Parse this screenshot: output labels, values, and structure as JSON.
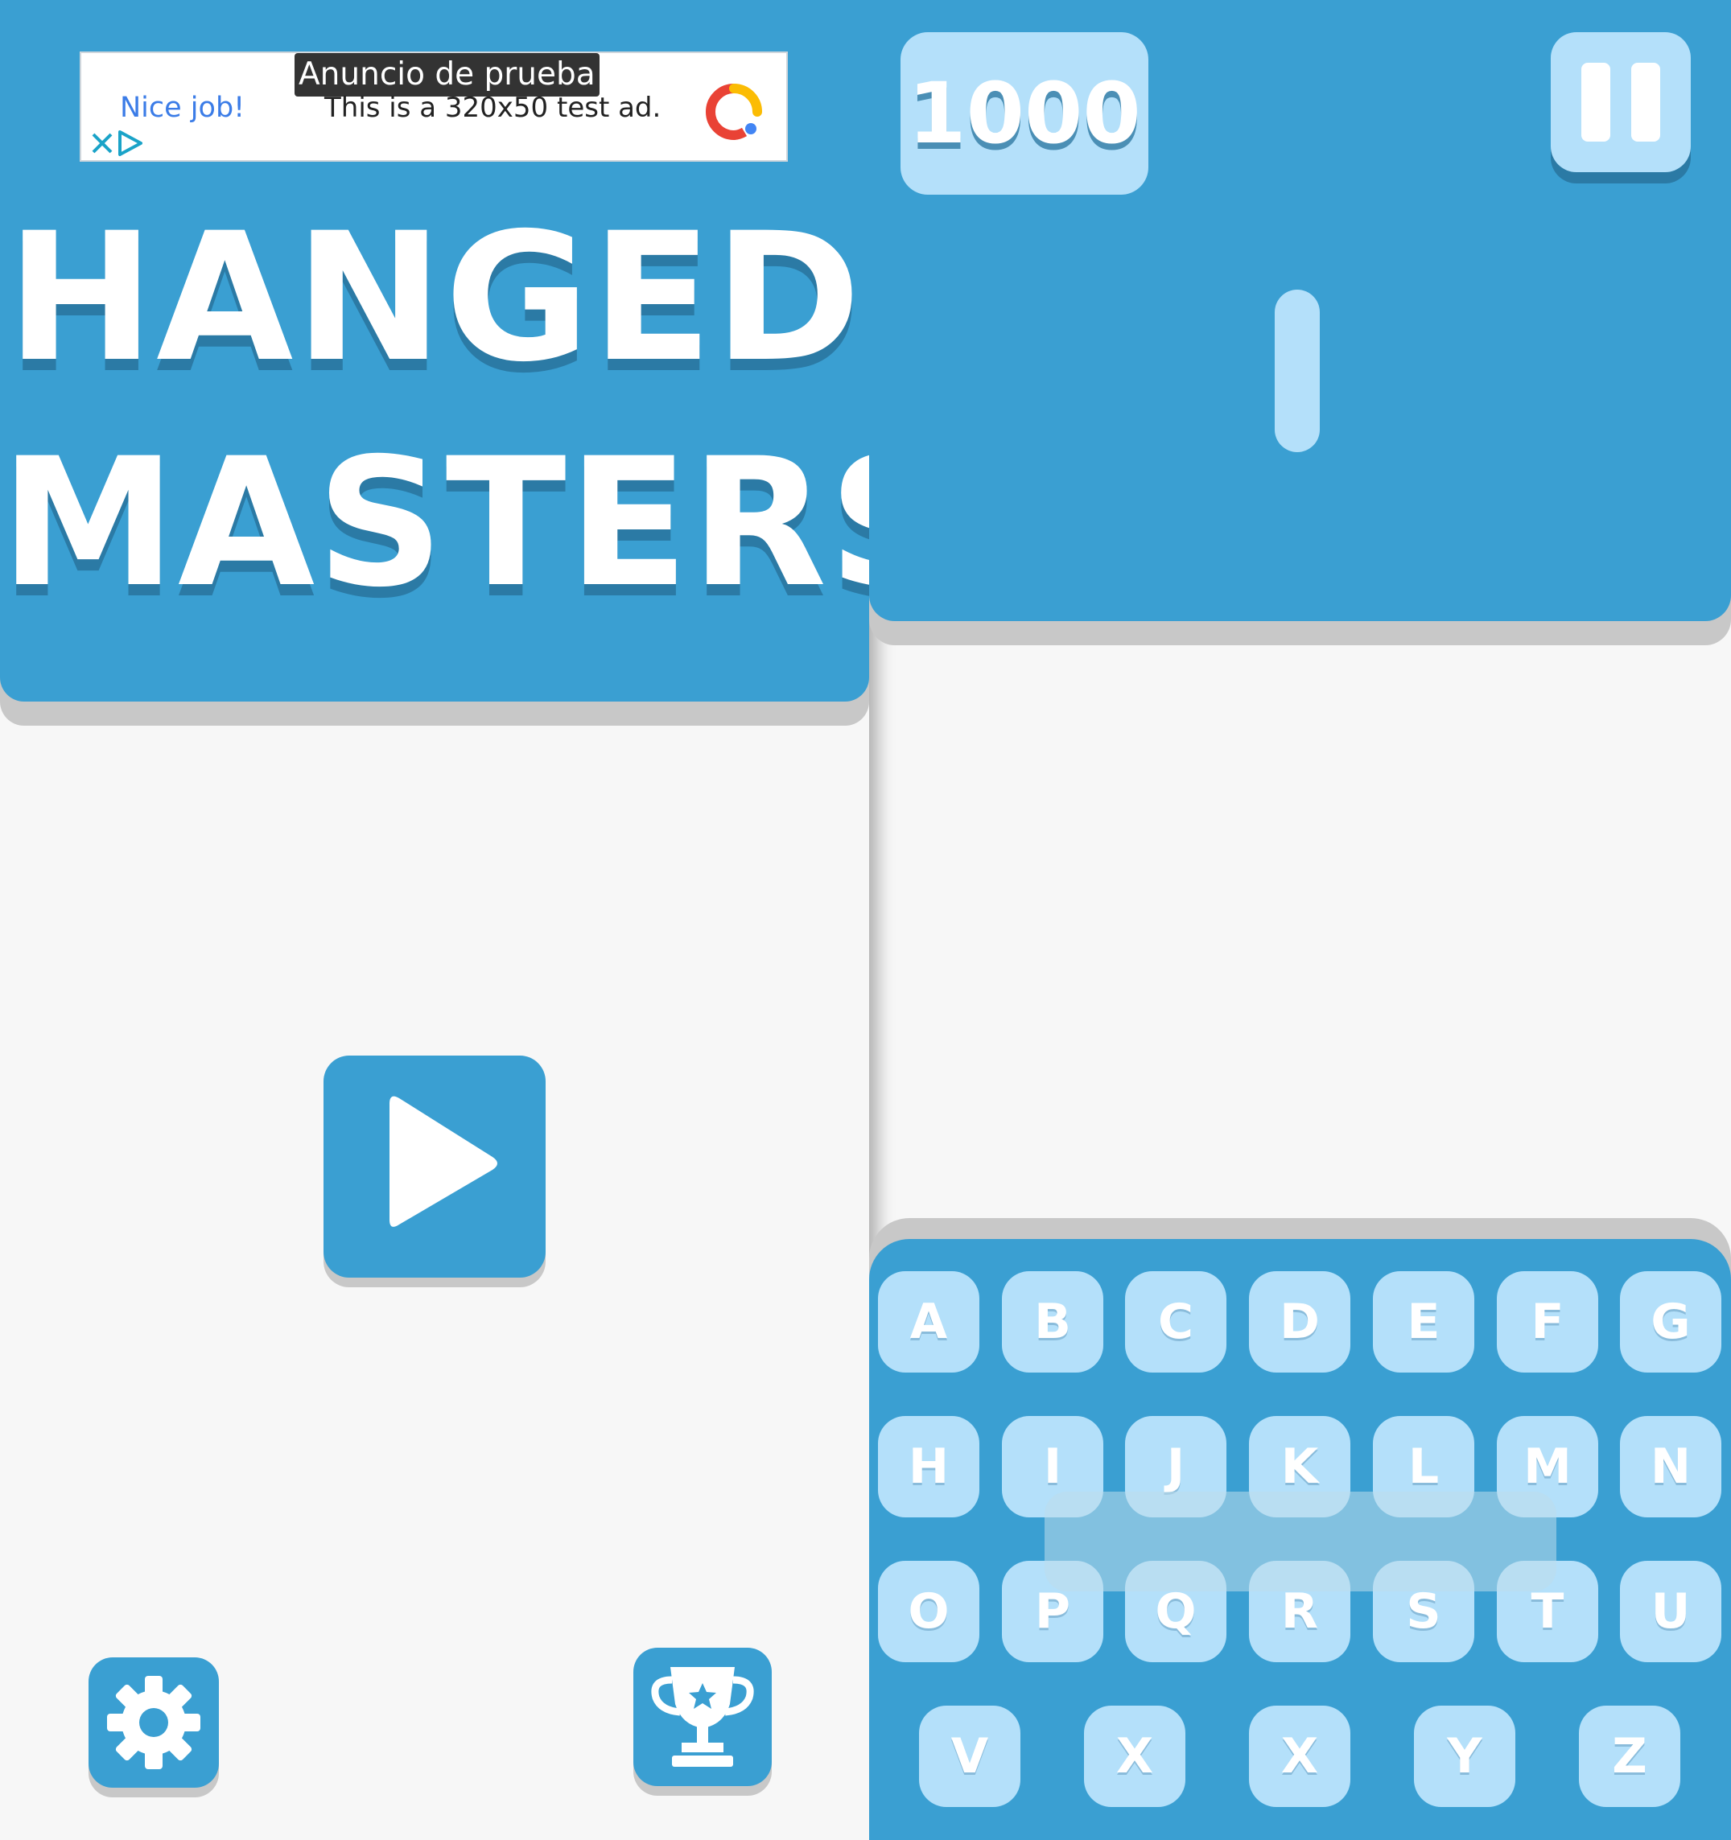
{
  "menu_screen": {
    "ad": {
      "label": "Anuncio de prueba",
      "headline": "Nice job!",
      "body": "This is a 320x50 test ad."
    },
    "title_line1": "HANGED",
    "title_line2": "MASTERS",
    "buttons": {
      "play_icon": "play-icon",
      "settings_icon": "gear-icon",
      "leaderboard_icon": "trophy-icon"
    }
  },
  "game_screen": {
    "score": "1000",
    "pause_icon": "pause-icon",
    "keyboard": {
      "rows": [
        [
          "A",
          "B",
          "C",
          "D",
          "E",
          "F",
          "G"
        ],
        [
          "H",
          "I",
          "J",
          "K",
          "L",
          "M",
          "N"
        ],
        [
          "O",
          "P",
          "Q",
          "R",
          "S",
          "T",
          "U"
        ],
        [
          "V",
          "X",
          "X",
          "Y",
          "Z"
        ]
      ]
    }
  },
  "colors": {
    "primary_blue": "#3a9fd2",
    "light_blue": "#b4e0fa",
    "background": "#f7f7f7",
    "shadow_gray": "#c8c8c8"
  }
}
